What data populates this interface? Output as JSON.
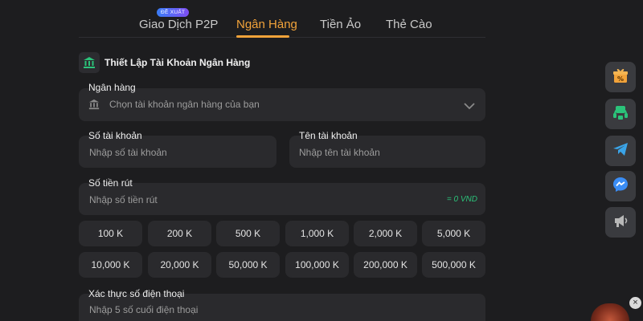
{
  "tabs": [
    {
      "label": "Giao Dịch P2P"
    },
    {
      "label": "Ngân Hàng"
    },
    {
      "label": "Tiền Ảo"
    },
    {
      "label": "Thẻ Cào"
    }
  ],
  "tab_badge": "ĐỀ XUẤT",
  "active_tab": "Ngân Hàng",
  "section": {
    "title": "Thiết Lập Tài Khoản Ngân Hàng"
  },
  "bank": {
    "label": "Ngân hàng",
    "placeholder": "Chọn tài khoản ngân hàng của bạn"
  },
  "account_number": {
    "label": "Số tài khoản",
    "placeholder": "Nhập số tài khoản"
  },
  "account_name": {
    "label": "Tên tài khoản",
    "placeholder": "Nhập tên tài khoản"
  },
  "withdraw": {
    "label": "Số tiền rút",
    "placeholder": "Nhập số tiền rút",
    "converted": "= 0 VND"
  },
  "amounts": [
    "100 K",
    "200 K",
    "500 K",
    "1,000 K",
    "2,000 K",
    "5,000 K",
    "10,000 K",
    "20,000 K",
    "50,000 K",
    "100,000 K",
    "200,000 K",
    "500,000 K"
  ],
  "phone": {
    "label": "Xác thực số điện thoại",
    "placeholder": "Nhập 5 số cuối điện thoại"
  },
  "side_buttons": [
    "gift-percent-icon",
    "headset-icon",
    "telegram-icon",
    "messenger-icon",
    "megaphone-icon"
  ],
  "colors": {
    "accent": "#f2a33a",
    "background": "#1d1d1f",
    "field": "#2a2a2d",
    "success": "#2bc37a",
    "badge": "#3a7df5"
  }
}
